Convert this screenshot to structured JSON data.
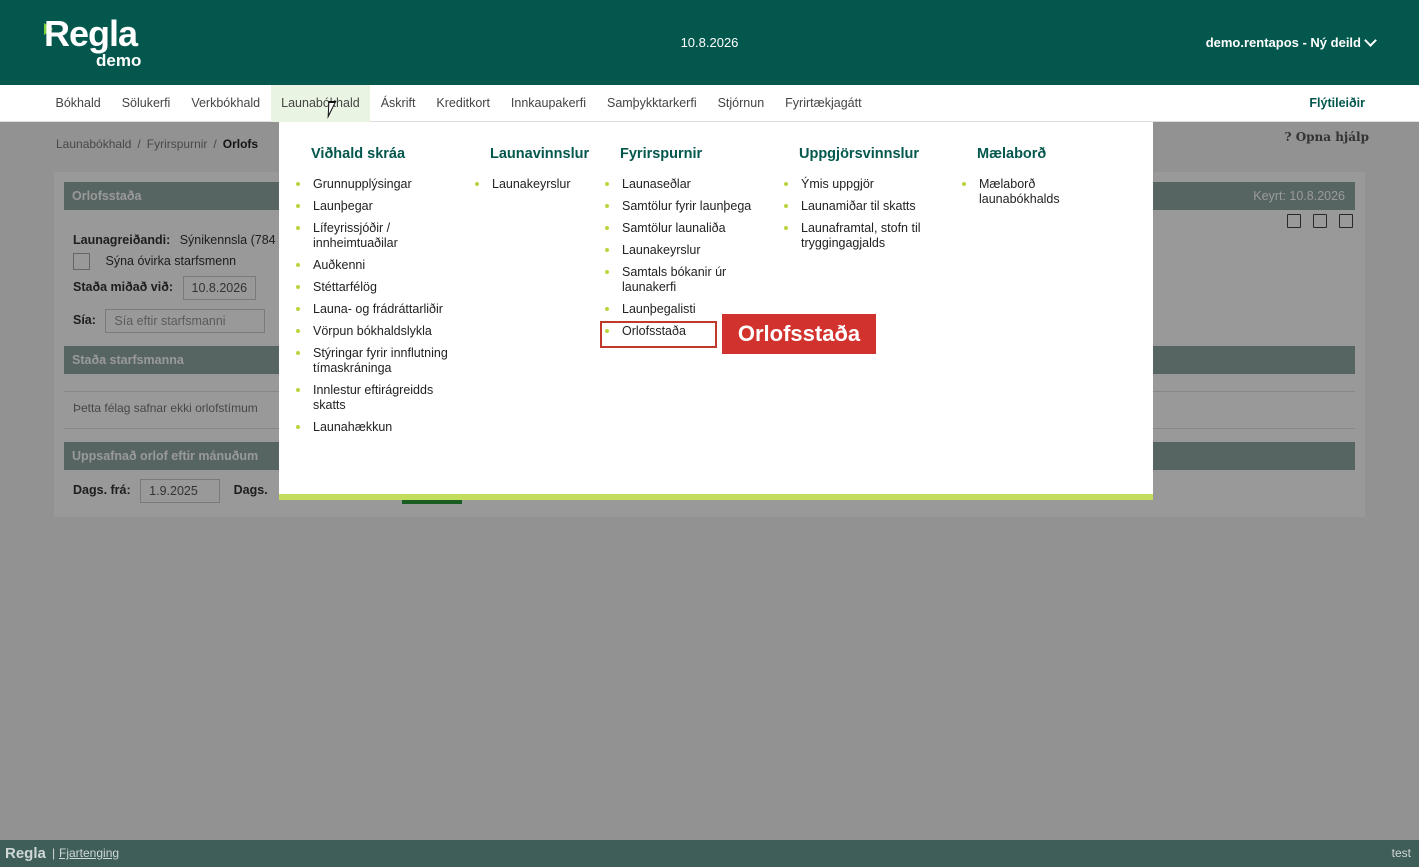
{
  "header": {
    "logo_text": "Regla",
    "logo_sub": "demo",
    "date": "10.8.2026",
    "user_menu": "demo.rentapos - Ný deild"
  },
  "nav": {
    "items": [
      {
        "label": "Bókhald"
      },
      {
        "label": "Sölukerfi"
      },
      {
        "label": "Verkbókhald"
      },
      {
        "label": "Launabókhald"
      },
      {
        "label": "Áskrift"
      },
      {
        "label": "Kreditkort"
      },
      {
        "label": "Innkaupakerfi"
      },
      {
        "label": "Samþykktarkerfi"
      },
      {
        "label": "Stjórnun"
      },
      {
        "label": "Fyrirtækjagátt"
      }
    ],
    "active": "Launabókhald",
    "shortcuts": "Flýtileiðir"
  },
  "page": {
    "breadcrumb": [
      "Launabókhald",
      "Fyrirspurnir",
      "Orlofs"
    ],
    "help": "Opna hjálp",
    "panel_title": "Orlofsstaða",
    "ran": "Keyrt: 10.8.2026",
    "employer_label": "Launagreiðandi:",
    "employer_value": "Sýnikennsla (784",
    "show_inactive": "Sýna óvirka starfsmenn",
    "status_at_label": "Staða miðað við:",
    "status_at_value": "10.8.2026",
    "filter_label": "Sía:",
    "filter_placeholder": "Sía eftir starfsmanni",
    "employee_status_title": "Staða starfsmanna",
    "notice": "Þetta félag safnar ekki orlofstímum",
    "accrued_title": "Uppsafnað orlof eftir mánuðum",
    "date_from_label": "Dags. frá:",
    "date_from_value": "1.9.2025",
    "date_to_label": "Dags."
  },
  "mega_menu": {
    "columns": [
      {
        "title": "Viðhald skráa",
        "items": [
          "Grunnupplýsingar",
          "Launþegar",
          "Lífeyrissjóðir / innheimtuaðilar",
          "Auðkenni",
          "Stéttarfélög",
          "Launa- og frádráttarliðir",
          "Vörpun bókhaldslykla",
          "Stýringar fyrir innflutning tímaskráninga",
          "Innlestur eftirágreidds skatts",
          "Launahækkun"
        ]
      },
      {
        "title": "Launavinnslur",
        "items": [
          "Launakeyrslur"
        ]
      },
      {
        "title": "Fyrirspurnir",
        "items": [
          "Launaseðlar",
          "Samtölur fyrir launþega",
          "Samtölur launaliða",
          "Launakeyrslur",
          "Samtals bókanir úr launakerfi",
          "Launþegalisti",
          "Orlofsstaða"
        ]
      },
      {
        "title": "Uppgjörsvinnslur",
        "items": [
          "Ýmis uppgjör",
          "Launamiðar til skatts",
          "Launaframtal, stofn til tryggingagjalds"
        ]
      },
      {
        "title": "Mælaborð",
        "items": [
          "Mælaborð launabókhalds"
        ]
      }
    ],
    "callout": "Orlofsstaða"
  },
  "footer": {
    "logo": "Regla",
    "separator": "|",
    "logout": "Fjartenging",
    "env": "test"
  },
  "colors": {
    "brand": "#03574d",
    "accent": "#b9d53f",
    "callout": "#d2322d"
  }
}
